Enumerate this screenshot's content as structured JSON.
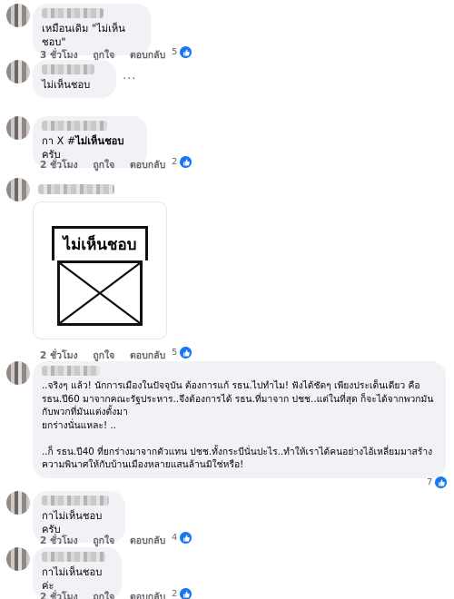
{
  "comments": [
    {
      "text": "เหมือนเดิม \"ไม่เห็นชอบ\"",
      "time": "3 ชั่วโมง",
      "like": "ถูกใจ",
      "reply": "ตอบกลับ",
      "reactions": "5"
    },
    {
      "text": "ไม่เห็นชอบ",
      "more": "..."
    },
    {
      "text_prefix": "กา X #",
      "hashtag": "ไม่เห็นชอบ",
      "text_suffix": " ครับ",
      "time": "2 ชั่วโมง",
      "like": "ถูกใจ",
      "reply": "ตอบกลับ",
      "reactions": "2"
    },
    {
      "image_text": "ไม่เห็นชอบ",
      "time": "2 ชั่วโมง",
      "like": "ถูกใจ",
      "reply": "ตอบกลับ",
      "reactions": "5"
    },
    {
      "text": "..จริงๆ แล้ว! นักการเมืองในปัจจุบัน ต้องการแก้ รธน.ไปทำไม! ฟังได้ชัดๆ เพียงประเด็นเดียว คือ\nรธน.ปี60 มาจากคณะรัฐประหาร..จึงต้องการได้ รธน.ที่มาจาก ปชช..แต่ในที่สุด ก็จะได้จากพวกมัน\nกับพวกที่มันแต่งตั้งมา\nยกร่างนั่นแหละ! ..\n\n..ก็ รธน.ปี40 ที่ยกร่างมาจากตัวแทน ปชช.ทั้งกระบีนั่นปะไร..ทำให้เราได้คนอย่างไอ้เหลี่ยมมาสร้าง\nความพินาศให้กับบ้านเมืองหลายแสนล้านมิใช่หรือ!",
      "reactions": "7"
    },
    {
      "text": "กาไม่เห็นชอบครับ",
      "time": "2 ชั่วโมง",
      "like": "ถูกใจ",
      "reply": "ตอบกลับ",
      "reactions": "4"
    },
    {
      "text": "กาไม่เห็นชอบค่ะ",
      "time": "2 ชั่วโมง",
      "like": "ถูกใจ",
      "reply": "ตอบกลับ",
      "reactions": "2"
    }
  ],
  "colors": {
    "bubble": "#f0f2f5",
    "meta": "#65676b",
    "like_badge": "#1877f2"
  },
  "icons": [
    "like-thumb-icon",
    "more-dots-icon"
  ]
}
